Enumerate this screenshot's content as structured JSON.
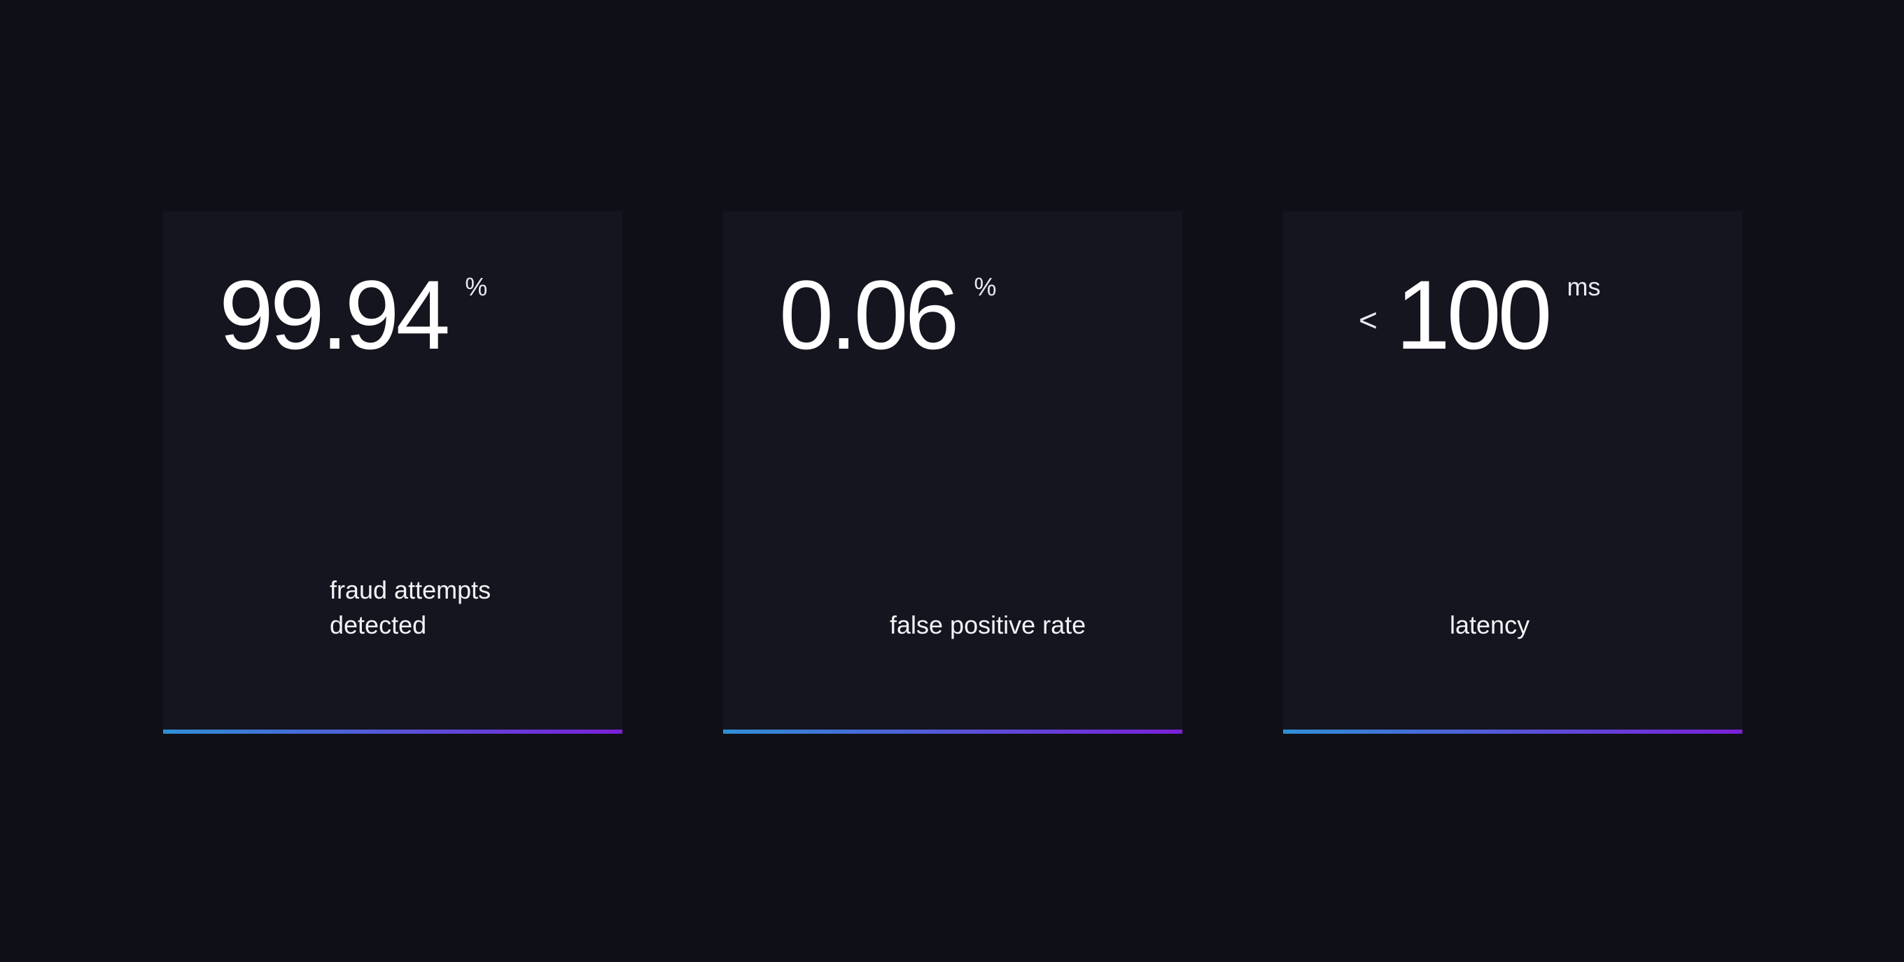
{
  "colors": {
    "background": "#0f1017",
    "card": "#14151e",
    "text": "#ffffff",
    "accent_gradient_start": "#2f8fd6",
    "accent_gradient_end": "#7a1fd8"
  },
  "stats": [
    {
      "prefix": "",
      "value": "99.94",
      "unit": "%",
      "label": "fraud attempts\ndetected"
    },
    {
      "prefix": "",
      "value": "0.06",
      "unit": "%",
      "label": "false positive rate"
    },
    {
      "prefix": "<",
      "value": "100",
      "unit": "ms",
      "label": "latency"
    }
  ]
}
